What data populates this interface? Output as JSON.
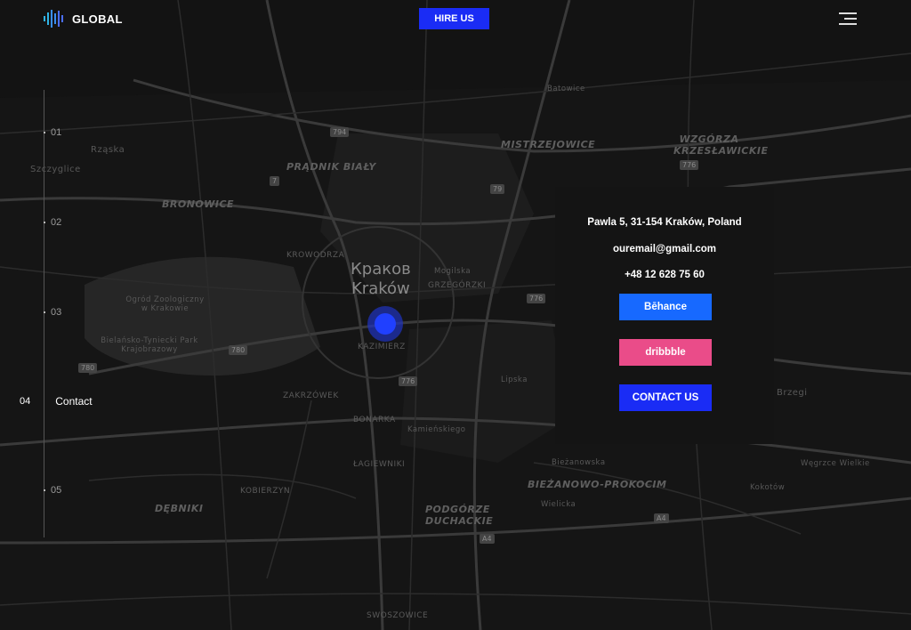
{
  "header": {
    "logo_text": "GLOBAL",
    "hire_label": "HIRE US"
  },
  "map": {
    "city_ru": "Краков",
    "city_pl": "Kraków",
    "labels": [
      "PRĄDNIK BIAŁY",
      "MISTRZEJOWICE",
      "WZGÓRZA KRZESŁAWICKIE",
      "BRONOWICE",
      "KROWODRZA",
      "GRZEGÓRZKI",
      "KAZIMIERZ",
      "ZAKRZÓWEK",
      "BONARKA",
      "ŁAGIEWNIKI",
      "DĘBNIKI",
      "PODGÓRZE DUCHACKIE",
      "BIEŻANOWO-PROKOCIM",
      "KOBIERZYN",
      "SWOSZOWICE",
      "Rząska",
      "Szczyglice",
      "Batowice",
      "Bielańsko-Tyniecki Park Krajobrazowy",
      "Ogród Zoologiczny w Krakowie",
      "Mogilska",
      "Lipska",
      "Kamieńskiego",
      "Bieżanowska",
      "Wielicka",
      "Brzegi",
      "Kokotów",
      "Węgrzce Wielkie"
    ],
    "road_badges": [
      "794",
      "7",
      "79",
      "776",
      "776",
      "780",
      "776",
      "780",
      "A4",
      "A4"
    ]
  },
  "nav": {
    "items": [
      {
        "num": "01"
      },
      {
        "num": "02"
      },
      {
        "num": "03"
      },
      {
        "num": "05"
      }
    ],
    "active": {
      "num": "04",
      "label": "Contact"
    }
  },
  "contact": {
    "address": "Pawla 5, 31-154 Kraków, Poland",
    "email": "ouremail@gmail.com",
    "phone": "+48 12 628 75 60",
    "behance_label": "Bēhance",
    "dribbble_label": "dribbble",
    "contact_label": "CONTACT US"
  },
  "colors": {
    "accent": "#1a2cf5",
    "behance": "#1769ff",
    "dribbble": "#ea4c89",
    "background": "#121212"
  }
}
